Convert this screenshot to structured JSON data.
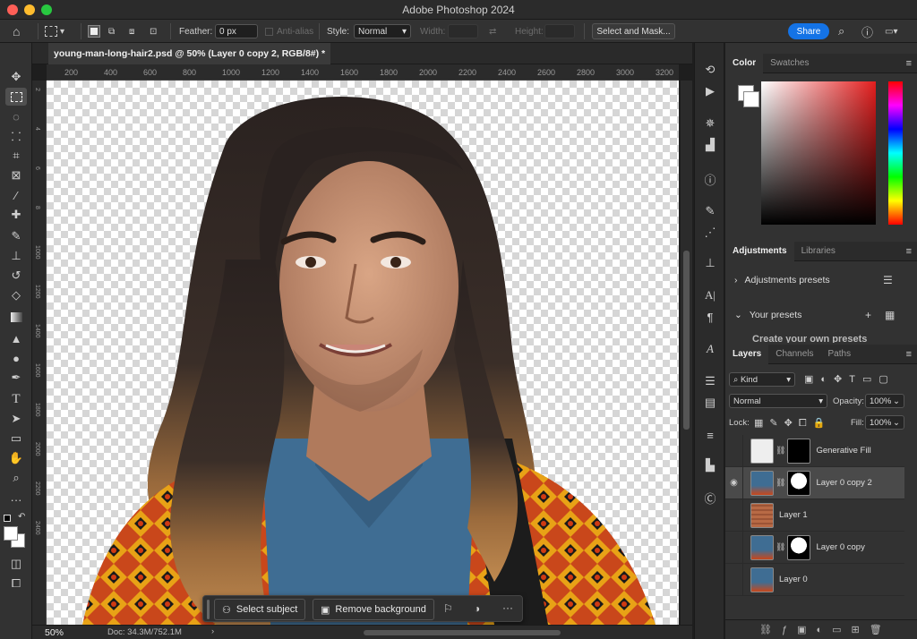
{
  "window": {
    "title": "Adobe Photoshop 2024",
    "share_label": "Share"
  },
  "options_bar": {
    "feather_label": "Feather:",
    "feather_value": "0 px",
    "antialias_label": "Anti-alias",
    "style_label": "Style:",
    "style_value": "Normal",
    "width_label": "Width:",
    "height_label": "Height:",
    "select_mask_label": "Select and Mask..."
  },
  "document": {
    "tab_label": "young-man-long-hair2.psd @ 50% (Layer 0 copy 2, RGB/8#) *"
  },
  "ruler": {
    "top_ticks": [
      "200",
      "400",
      "600",
      "800",
      "1000",
      "1200",
      "1400",
      "1600",
      "1800",
      "2000",
      "2200",
      "2400",
      "2600",
      "2800",
      "3000",
      "3200"
    ],
    "left_ticks": [
      "2",
      "4",
      "6",
      "8",
      "1000",
      "1200",
      "1400",
      "1600",
      "1800",
      "2000",
      "2200",
      "2400"
    ]
  },
  "status": {
    "zoom": "50%",
    "doc": "Doc: 34.3M/752.1M"
  },
  "context_bar": {
    "select_subject": "Select subject",
    "remove_background": "Remove background"
  },
  "panels": {
    "color_tab": "Color",
    "swatches_tab": "Swatches",
    "adjustments_tab": "Adjustments",
    "libraries_tab": "Libraries",
    "adjustments_presets": "Adjustments presets",
    "your_presets": "Your presets",
    "create_presets": "Create your own presets",
    "layers_tab": "Layers",
    "channels_tab": "Channels",
    "paths_tab": "Paths",
    "kind_label": "Kind",
    "blend_mode": "Normal",
    "opacity_label": "Opacity:",
    "opacity_value": "100%",
    "lock_label": "Lock:",
    "fill_label": "Fill:",
    "fill_value": "100%"
  },
  "layers": [
    {
      "name": "Generative Fill"
    },
    {
      "name": "Layer 0 copy 2"
    },
    {
      "name": "Layer 1"
    },
    {
      "name": "Layer 0 copy"
    },
    {
      "name": "Layer 0"
    }
  ],
  "colors": {
    "accent": "#1473e6"
  }
}
